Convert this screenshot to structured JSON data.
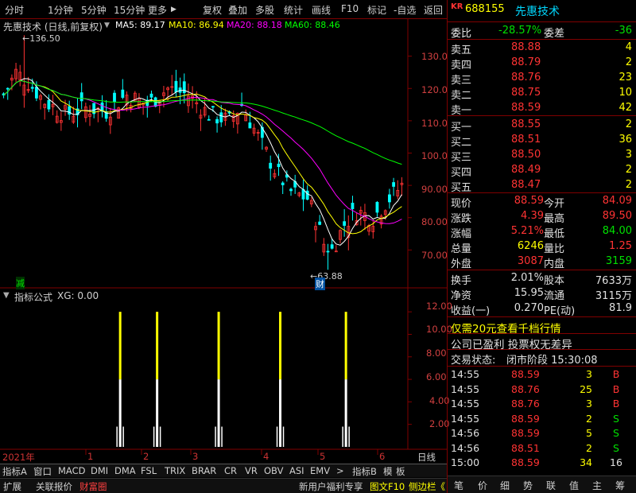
{
  "toolbar": {
    "left": [
      "分时",
      "1分钟",
      "5分钟",
      "15分钟",
      "更多"
    ],
    "more_arrow": "▶",
    "right": [
      "复权",
      "叠加",
      "多股",
      "统计",
      "画线",
      "F10",
      "标记",
      "-自选",
      "返回"
    ]
  },
  "chart_header": {
    "title": "先惠技术 (日线,前复权)",
    "ma5": "MA5: 89.17",
    "ma10": "MA10: 86.94",
    "ma20": "MA20: 88.18",
    "ma60": "MA60: 88.46"
  },
  "colors": {
    "ma5": "#ffffff",
    "ma10": "#ffff00",
    "ma20": "#ff00ff",
    "ma60": "#00ff00",
    "up": "#ff3333",
    "down": "#00ffff",
    "grid": "#800000"
  },
  "price_axis": {
    "ticks": [
      "130.0",
      "120.0",
      "110.0",
      "100.0",
      "90.00",
      "80.00",
      "70.00"
    ]
  },
  "annotations": {
    "high": "136.50",
    "low": "63.88",
    "jian": "减",
    "cai": "财"
  },
  "indicator": {
    "name": "指标公式",
    "value": "XG: 0.00",
    "ticks": [
      "12.00",
      "10.00",
      "8.00",
      "6.00",
      "4.00",
      "2.00"
    ]
  },
  "chart_data": {
    "type": "candlestick",
    "price_ylim": [
      60,
      140
    ],
    "indicator_ylim": [
      0,
      13
    ],
    "signals_x": [
      28,
      37,
      52,
      67,
      83
    ],
    "signals_value": 12
  },
  "date_axis": [
    "2021年",
    "1",
    "2",
    "3",
    "4",
    "5",
    "6",
    "日线"
  ],
  "tabs_row1": [
    "指标A",
    "窗口",
    "MACD",
    "DMI",
    "DMA",
    "FSL",
    "TRIX",
    "BRAR",
    "CR",
    "VR",
    "OBV",
    "ASI",
    "EMV",
    ">",
    "指标B",
    "模",
    "板"
  ],
  "tabs_row2": {
    "items": [
      "扩展",
      "关联报价",
      "财富圈"
    ],
    "promo": "新用户福利专享",
    "f10": "图文F10",
    "sidebar": "侧边栏《"
  },
  "quote": {
    "kr": "KR",
    "code": "688155",
    "name": "先惠技术",
    "weibi_label": "委比",
    "weibi": "-28.57%",
    "weicha_label": "委差",
    "weicha": "-36",
    "asks": [
      {
        "label": "卖五",
        "price": "88.88",
        "vol": "4"
      },
      {
        "label": "卖四",
        "price": "88.79",
        "vol": "2"
      },
      {
        "label": "卖三",
        "price": "88.76",
        "vol": "23"
      },
      {
        "label": "卖二",
        "price": "88.75",
        "vol": "10"
      },
      {
        "label": "卖一",
        "price": "88.59",
        "vol": "42"
      }
    ],
    "bids": [
      {
        "label": "买一",
        "price": "88.55",
        "vol": "2"
      },
      {
        "label": "买二",
        "price": "88.51",
        "vol": "36"
      },
      {
        "label": "买三",
        "price": "88.50",
        "vol": "3"
      },
      {
        "label": "买四",
        "price": "88.49",
        "vol": "2"
      },
      {
        "label": "买五",
        "price": "88.47",
        "vol": "2"
      }
    ],
    "stats": [
      {
        "l1": "现价",
        "v1": "88.59",
        "l2": "今开",
        "v2": "84.09",
        "c1": "red",
        "c2": "red"
      },
      {
        "l1": "涨跌",
        "v1": "4.39",
        "l2": "最高",
        "v2": "89.50",
        "c1": "red",
        "c2": "red"
      },
      {
        "l1": "涨幅",
        "v1": "5.21%",
        "l2": "最低",
        "v2": "84.00",
        "c1": "red",
        "c2": "green"
      },
      {
        "l1": "总量",
        "v1": "6246",
        "l2": "量比",
        "v2": "1.25",
        "c1": "yel",
        "c2": "red"
      },
      {
        "l1": "外盘",
        "v1": "3087",
        "l2": "内盘",
        "v2": "3159",
        "c1": "red",
        "c2": "green"
      }
    ],
    "stats2": [
      {
        "l1": "换手",
        "v1": "2.01%",
        "l2": "股本",
        "v2": "7633万"
      },
      {
        "l1": "净资",
        "v1": "15.95",
        "l2": "流通",
        "v2": "3115万"
      },
      {
        "l1": "收益(一)",
        "v1": "0.270",
        "l2": "PE(动)",
        "v2": "81.9"
      }
    ],
    "promo": "仅需20元查看千档行情",
    "news": "公司已盈利 投票权无差异",
    "status_label": "交易状态:",
    "status": "闭市阶段 15:30:08",
    "ticks": [
      {
        "t": "14:55",
        "p": "88.59",
        "v": "3",
        "s": "B"
      },
      {
        "t": "14:55",
        "p": "88.76",
        "v": "25",
        "s": "B"
      },
      {
        "t": "14:55",
        "p": "88.76",
        "v": "3",
        "s": "B"
      },
      {
        "t": "14:55",
        "p": "88.59",
        "v": "2",
        "s": "S"
      },
      {
        "t": "14:56",
        "p": "88.59",
        "v": "5",
        "s": "S"
      },
      {
        "t": "14:56",
        "p": "88.51",
        "v": "2",
        "s": "S"
      },
      {
        "t": "15:00",
        "p": "88.59",
        "v": "34",
        "s": "16"
      }
    ],
    "bottom_tabs": [
      "笔",
      "价",
      "细",
      "势",
      "联",
      "值",
      "主",
      "筹"
    ]
  }
}
